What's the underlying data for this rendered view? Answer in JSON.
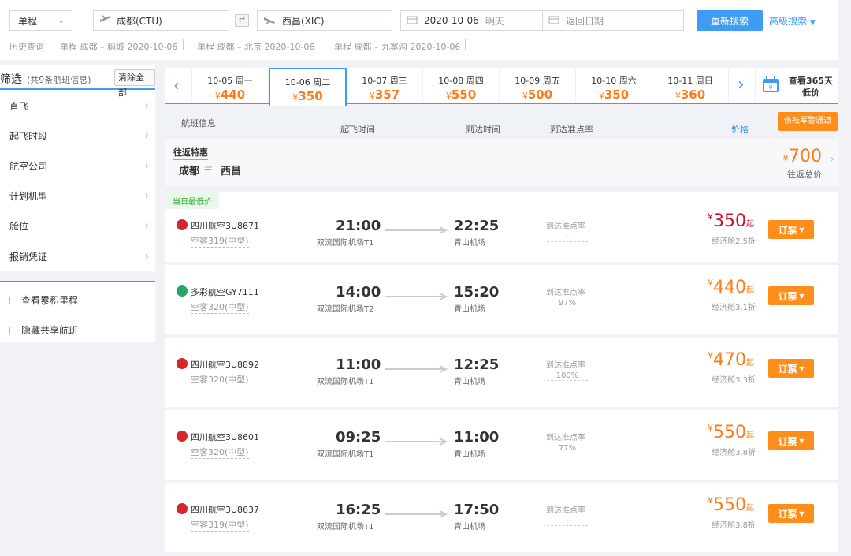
{
  "search": {
    "trip_type": "单程",
    "from": "成都(CTU)",
    "to": "西昌(XIC)",
    "depart_date": "2020-10-06",
    "depart_hint": "明天",
    "return_placeholder": "返回日期",
    "search_btn": "重新搜索",
    "advanced": "高级搜索"
  },
  "history": {
    "label": "历史查询",
    "items": [
      "单程 成都 – 稻城 2020-10-06",
      "单程 成都 – 北京 2020-10-06",
      "单程 成都 – 九寨沟 2020-10-06"
    ]
  },
  "filter": {
    "title": "筛选",
    "count": "(共9条航班信息)",
    "clear": "清除全部",
    "items": [
      "直飞",
      "起飞时段",
      "航空公司",
      "计划机型",
      "舱位",
      "报销凭证"
    ],
    "checks": [
      "查看累积里程",
      "隐藏共享航班"
    ]
  },
  "dates": [
    {
      "d": "10-05 周一",
      "p": "440"
    },
    {
      "d": "10-06 周二",
      "p": "350"
    },
    {
      "d": "10-07 周三",
      "p": "357"
    },
    {
      "d": "10-08 周四",
      "p": "550"
    },
    {
      "d": "10-09 周五",
      "p": "500"
    },
    {
      "d": "10-10 周六",
      "p": "350"
    },
    {
      "d": "10-11 周日",
      "p": "360"
    }
  ],
  "calendar": {
    "line1": "查看365天",
    "line2": "低价"
  },
  "yen": "¥",
  "header": {
    "flight": "航班信息",
    "dep": "起飞时间",
    "arr": "到达时间",
    "ontime": "到达准点率",
    "price": "价格",
    "military": "伤残军警通道"
  },
  "roundtrip": {
    "title": "往返特惠",
    "from": "成都",
    "to": "西昌",
    "price": "700",
    "note": "往返总价"
  },
  "flights": [
    {
      "tag": "当日最低价",
      "airline": "四川航空3U8671",
      "plane": "空客319(中型)",
      "dep": "21:00",
      "dep_ap": "双流国际机场T1",
      "arr": "22:25",
      "arr_ap": "青山机场",
      "ot_label": "到达准点率",
      "ot": "-",
      "price": "350",
      "qi": "起",
      "cls": "经济舱2.5折",
      "book": "订票",
      "price_color": "#c8102e",
      "logo_color": "#d7262b"
    },
    {
      "tag": "",
      "airline": "多彩航空GY7111",
      "plane": "空客320(中型)",
      "dep": "14:00",
      "dep_ap": "双流国际机场T2",
      "arr": "15:20",
      "arr_ap": "青山机场",
      "ot_label": "到达准点率",
      "ot": "97%",
      "price": "440",
      "qi": "起",
      "cls": "经济舱3.1折",
      "book": "订票",
      "price_color": "#ff7b1a",
      "logo_color": "#2aa56a"
    },
    {
      "tag": "",
      "airline": "四川航空3U8892",
      "plane": "空客320(中型)",
      "dep": "11:00",
      "dep_ap": "双流国际机场T1",
      "arr": "12:25",
      "arr_ap": "青山机场",
      "ot_label": "到达准点率",
      "ot": "100%",
      "price": "470",
      "qi": "起",
      "cls": "经济舱3.3折",
      "book": "订票",
      "price_color": "#ff7b1a",
      "logo_color": "#d7262b"
    },
    {
      "tag": "",
      "airline": "四川航空3U8601",
      "plane": "空客320(中型)",
      "dep": "09:25",
      "dep_ap": "双流国际机场T1",
      "arr": "11:00",
      "arr_ap": "青山机场",
      "ot_label": "到达准点率",
      "ot": "77%",
      "price": "550",
      "qi": "起",
      "cls": "经济舱3.8折",
      "book": "订票",
      "price_color": "#ff7b1a",
      "logo_color": "#d7262b"
    },
    {
      "tag": "",
      "airline": "四川航空3U8637",
      "plane": "空客319(中型)",
      "dep": "16:25",
      "dep_ap": "双流国际机场T1",
      "arr": "17:50",
      "arr_ap": "青山机场",
      "ot_label": "到达准点率",
      "ot": "-",
      "price": "550",
      "qi": "起",
      "cls": "经济舱3.8折",
      "book": "订票",
      "price_color": "#ff7b1a",
      "logo_color": "#d7262b"
    }
  ]
}
